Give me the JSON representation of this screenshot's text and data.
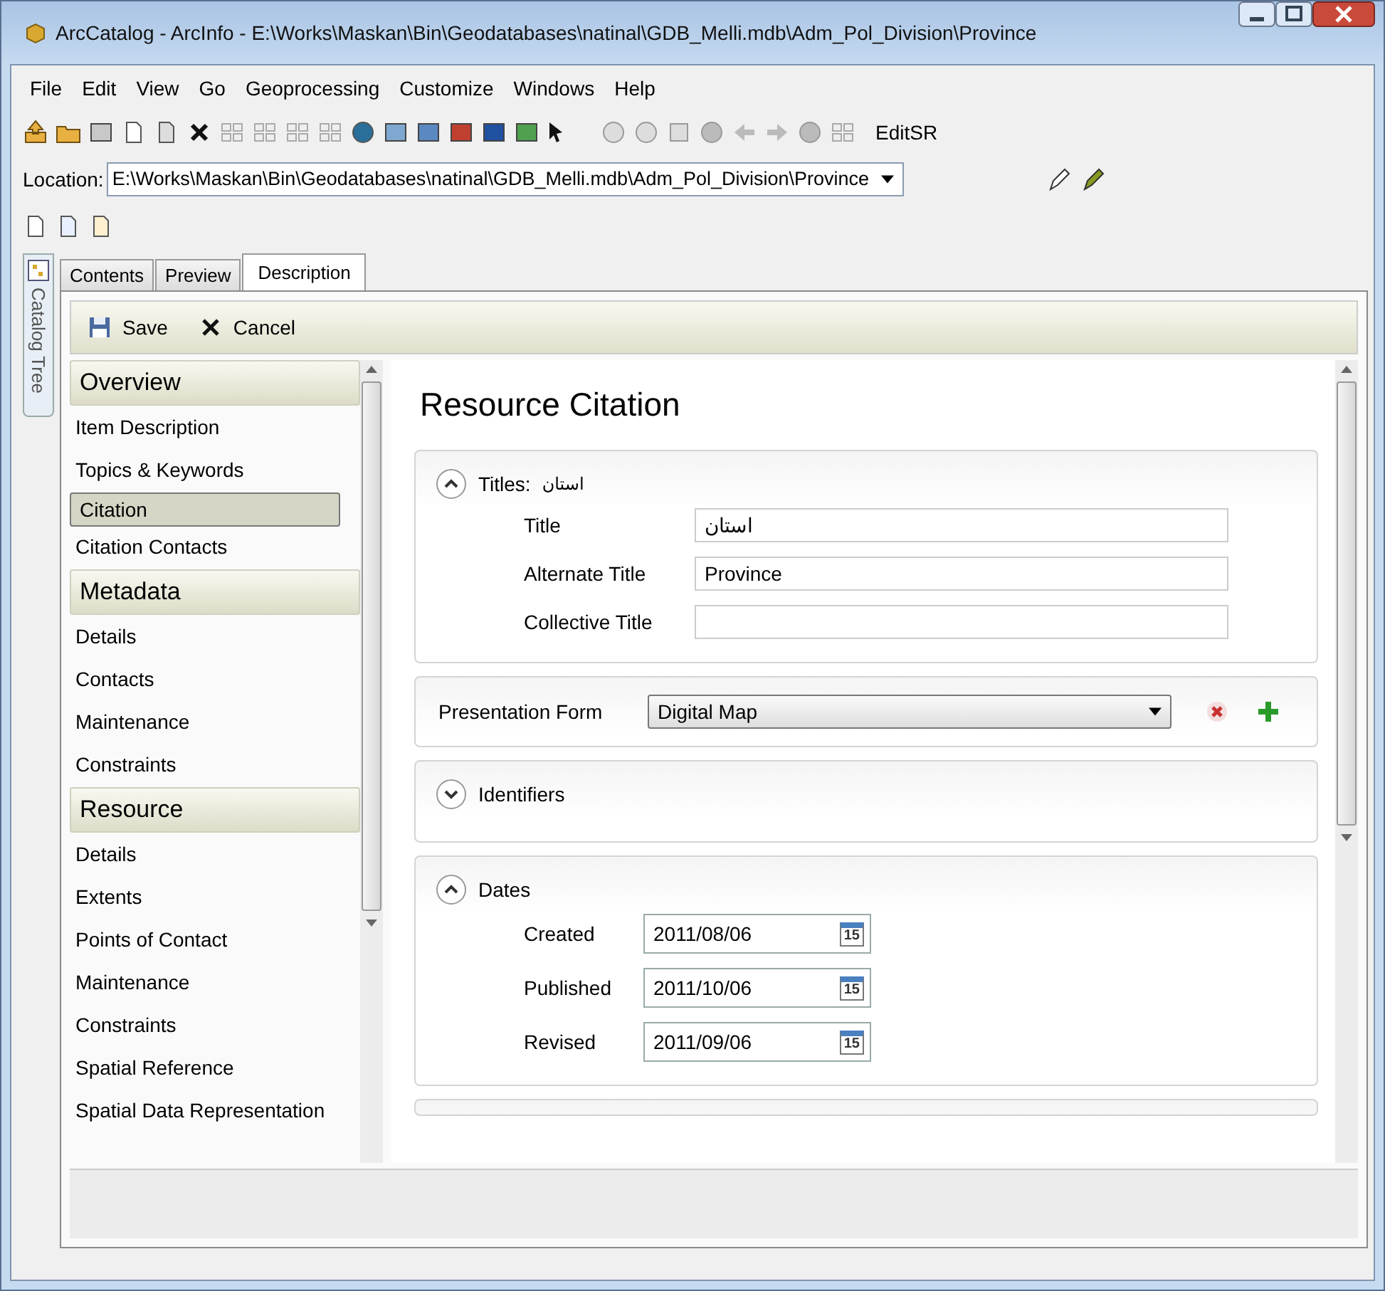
{
  "window": {
    "title": "ArcCatalog - ArcInfo - E:\\Works\\Maskan\\Bin\\Geodatabases\\natinal\\GDB_Melli.mdb\\Adm_Pol_Division\\Province"
  },
  "menu": [
    "File",
    "Edit",
    "View",
    "Go",
    "Geoprocessing",
    "Customize",
    "Windows",
    "Help"
  ],
  "toolbar": {
    "edit_sr_label": "EditSR"
  },
  "location": {
    "label": "Location:",
    "value": "E:\\Works\\Maskan\\Bin\\Geodatabases\\natinal\\GDB_Melli.mdb\\Adm_Pol_Division\\Province"
  },
  "catalog_tree_tab": {
    "label": "Catalog Tree"
  },
  "tabs": [
    {
      "label": "Contents",
      "selected": false
    },
    {
      "label": "Preview",
      "selected": false
    },
    {
      "label": "Description",
      "selected": true
    }
  ],
  "actions": [
    {
      "kind": "save",
      "label": "Save"
    },
    {
      "kind": "cancel",
      "label": "Cancel"
    }
  ],
  "nav": [
    {
      "heading": "Overview",
      "items": [
        {
          "label": "Item Description",
          "selected": false
        },
        {
          "label": "Topics & Keywords",
          "selected": false
        },
        {
          "label": "Citation",
          "selected": true
        },
        {
          "label": "Citation Contacts",
          "selected": false
        }
      ]
    },
    {
      "heading": "Metadata",
      "items": [
        {
          "label": "Details",
          "selected": false
        },
        {
          "label": "Contacts",
          "selected": false
        },
        {
          "label": "Maintenance",
          "selected": false
        },
        {
          "label": "Constraints",
          "selected": false
        }
      ]
    },
    {
      "heading": "Resource",
      "items": [
        {
          "label": "Details",
          "selected": false
        },
        {
          "label": "Extents",
          "selected": false
        },
        {
          "label": "Points of Contact",
          "selected": false
        },
        {
          "label": "Maintenance",
          "selected": false
        },
        {
          "label": "Constraints",
          "selected": false
        },
        {
          "label": "Spatial Reference",
          "selected": false
        },
        {
          "label": "Spatial Data Representation",
          "selected": false
        }
      ]
    }
  ],
  "content": {
    "heading": "Resource Citation",
    "sections": [
      {
        "kind": "group",
        "label": "Titles:",
        "value": "استان",
        "expanded": true,
        "fields": [
          {
            "kind": "text",
            "label": "Title",
            "value": "استان"
          },
          {
            "kind": "text",
            "label": "Alternate Title",
            "value": "Province"
          },
          {
            "kind": "text",
            "label": "Collective Title"
          }
        ]
      },
      {
        "kind": "dropdown",
        "label": "Presentation Form",
        "value": "Digital Map"
      },
      {
        "kind": "group",
        "label": "Identifiers",
        "expanded": false
      },
      {
        "kind": "group",
        "label": "Dates",
        "expanded": true,
        "fields": [
          {
            "kind": "date",
            "label": "Created",
            "value": "2011/08/06",
            "calendar_day": "15"
          },
          {
            "kind": "date",
            "label": "Published",
            "value": "2011/10/06",
            "calendar_day": "15"
          },
          {
            "kind": "date",
            "label": "Revised",
            "value": "2011/09/06",
            "calendar_day": "15"
          }
        ]
      },
      {
        "kind": "partial"
      }
    ]
  }
}
